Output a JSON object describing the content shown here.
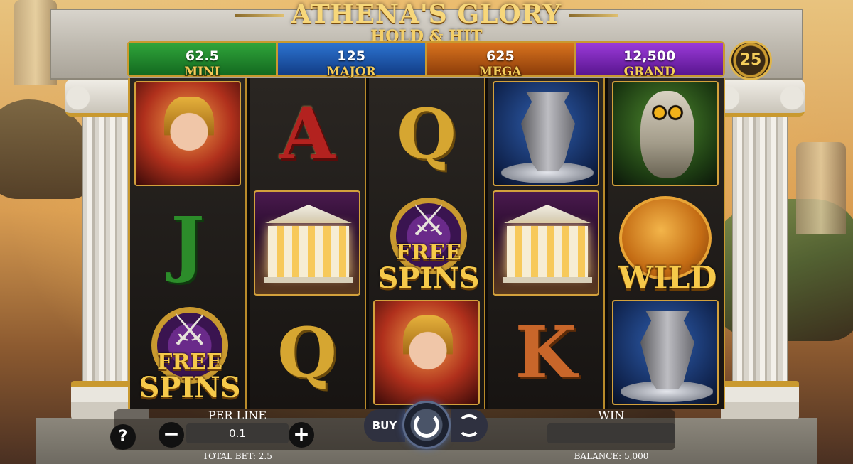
{
  "game": {
    "title": "ATHENA'S GLORY",
    "subtitle": "HOLD & HIT",
    "lines": "25"
  },
  "jackpots": [
    {
      "label": "MINI",
      "value": "62.5",
      "color": "#2fa43a"
    },
    {
      "label": "MAJOR",
      "value": "125",
      "color": "#2c73d0"
    },
    {
      "label": "MEGA",
      "value": "625",
      "color": "#d9731e"
    },
    {
      "label": "GRAND",
      "value": "12,500",
      "color": "#9a3ad8"
    }
  ],
  "reels": [
    [
      "athena",
      "J",
      "free-spins"
    ],
    [
      "A",
      "temple",
      "Q"
    ],
    [
      "Q",
      "free-spins",
      "athena"
    ],
    [
      "vase",
      "temple",
      "K"
    ],
    [
      "owl",
      "wild",
      "vase"
    ]
  ],
  "symbols": {
    "free_spins_line1": "FREE",
    "free_spins_line2": "SPINS",
    "wild": "WILD",
    "letter_A": "A",
    "letter_Q": "Q",
    "letter_J": "J",
    "letter_K": "K"
  },
  "controls": {
    "help": "?",
    "per_line_label": "PER LINE",
    "per_line_value": "0.1",
    "minus": "−",
    "plus": "+",
    "total_bet": "TOTAL BET: 2.5",
    "buy": "BUY",
    "win_label": "WIN",
    "win_value": "",
    "balance": "BALANCE: 5,000"
  }
}
